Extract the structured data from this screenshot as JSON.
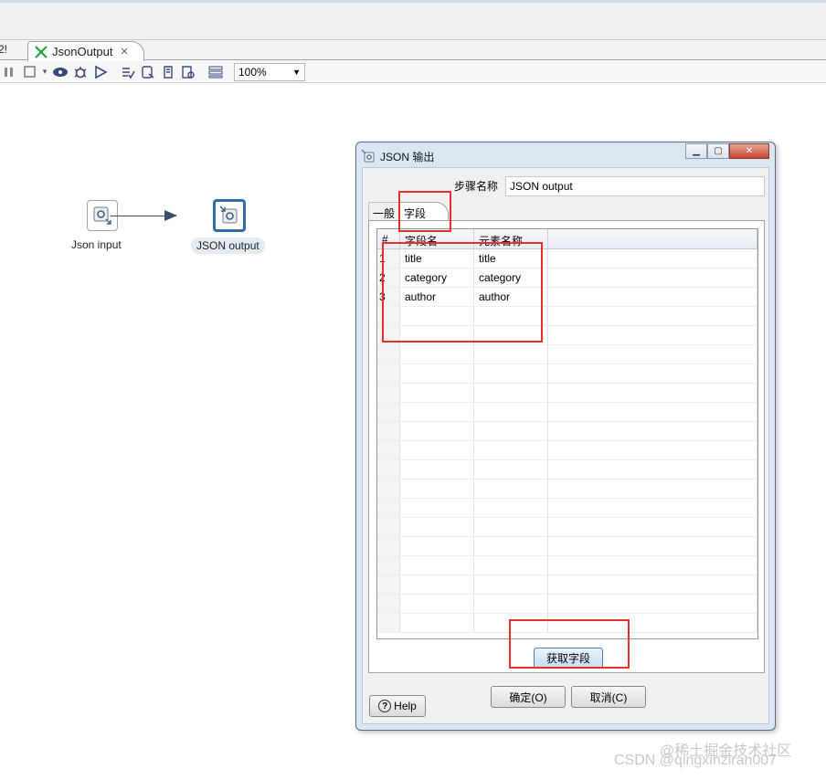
{
  "top_tabs": {
    "prev_tab_label": "2!",
    "active_tab_label": "JsonOutput",
    "close_glyph": "✕"
  },
  "toolbar": {
    "icons": [
      "pause-icon",
      "stop-icon",
      "dropdown-arrow-icon",
      "preview-eye-icon",
      "debug-bug-icon",
      "run-play-icon",
      "verify-icon",
      "sql-icon",
      "impact-icon",
      "explore-db-icon",
      "grid-layout-icon"
    ],
    "zoom_value": "100%"
  },
  "canvas": {
    "steps": [
      {
        "label": "Json input",
        "icon": "json-input-icon"
      },
      {
        "label": "JSON output",
        "icon": "json-output-icon"
      }
    ]
  },
  "dialog": {
    "title": "JSON 输出",
    "step_name_label": "步骤名称",
    "step_name_value": "JSON output",
    "tabs": [
      "一般",
      "字段"
    ],
    "grid": {
      "headers": [
        "#",
        "字段名",
        "元素名称",
        ""
      ],
      "rows": [
        [
          "1",
          "title",
          "title"
        ],
        [
          "2",
          "category",
          "category"
        ],
        [
          "3",
          "author",
          "author"
        ]
      ]
    },
    "get_fields_button": "获取字段",
    "help_button": "Help",
    "ok_button": "确定(O)",
    "cancel_button": "取消(C)"
  },
  "watermarks": {
    "line1": "@稀土掘金技术社区",
    "line2": "CSDN @qingxinziran007"
  },
  "colors": {
    "annotation_red": "#e8302a",
    "selected_step_border": "#2e6fa5",
    "dialog_frame": "#dbe6f3"
  }
}
